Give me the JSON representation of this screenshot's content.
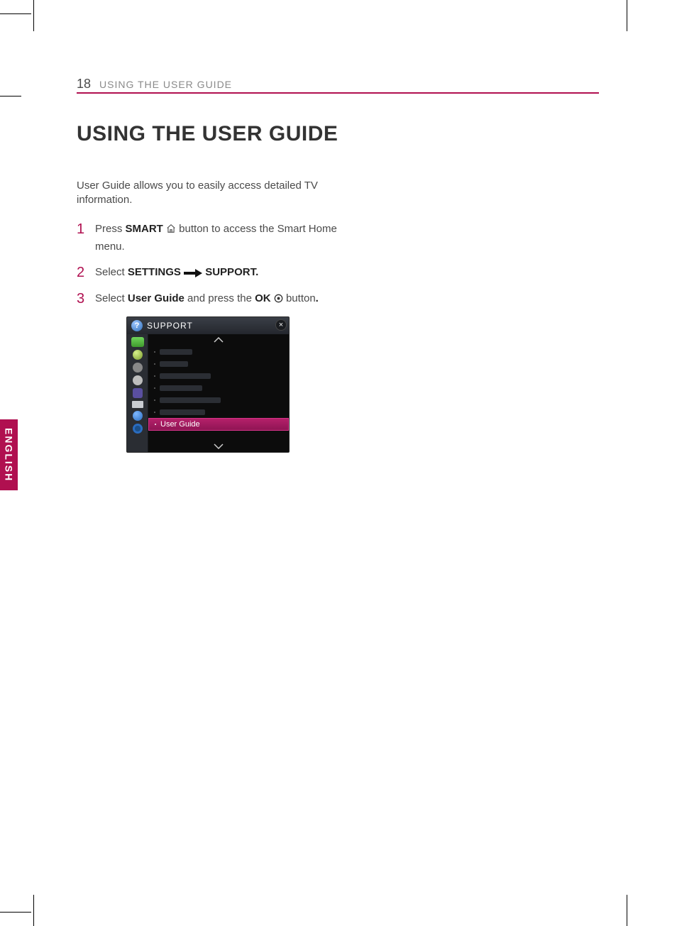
{
  "page_number": "18",
  "header_label": "USING THE USER GUIDE",
  "title": "USING THE USER GUIDE",
  "intro": "User Guide allows you to easily access detailed TV information.",
  "steps": {
    "s1": {
      "num": "1",
      "pre": "Press ",
      "bold1": "SMART",
      "post": " button to access the Smart Home menu."
    },
    "s2": {
      "num": "2",
      "pre": "Select ",
      "bold1": "SETTINGS",
      "bold2": "SUPPORT.",
      "mid": " "
    },
    "s3": {
      "num": "3",
      "pre": "Select ",
      "bold1": "User Guide",
      "mid": " and press the ",
      "bold2": "OK",
      "post": " button",
      "period": "."
    }
  },
  "lang_tab": "ENGLISH",
  "tv": {
    "header": "SUPPORT",
    "selected": "User Guide"
  }
}
